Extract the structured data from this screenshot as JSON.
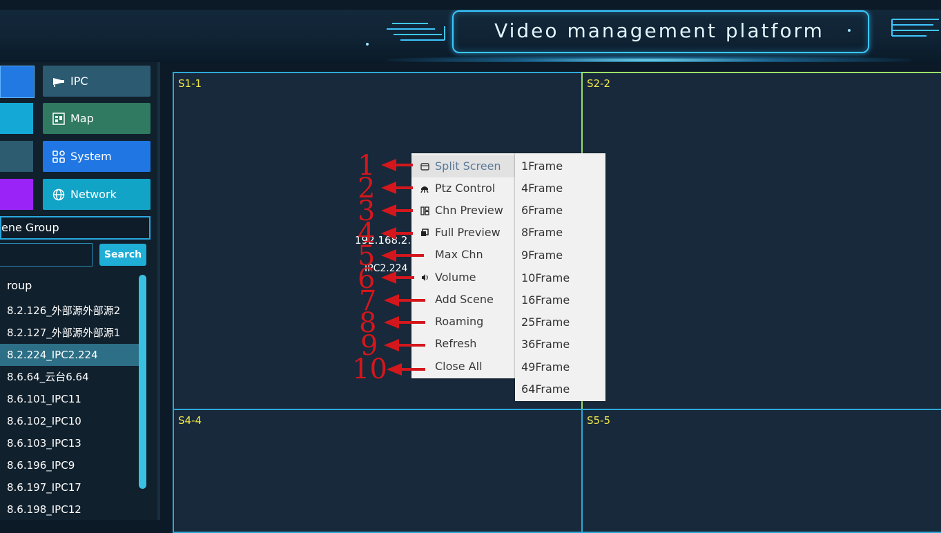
{
  "header": {
    "title": "Video management platform"
  },
  "nav": {
    "buttons": [
      {
        "label": "IPC",
        "icon": "camera-icon",
        "color": "#2c5a71",
        "left_color": "#2279e2"
      },
      {
        "label": "Map",
        "icon": "map-icon",
        "color": "#2f7a60",
        "left_color": "#13a8d6"
      },
      {
        "label": "System",
        "icon": "grid-icon",
        "color": "#2076e2",
        "left_color": "#2d5b70"
      },
      {
        "label": "Network",
        "icon": "globe-icon",
        "color": "#12a4c6",
        "left_color": "#9a23f7"
      }
    ]
  },
  "group_tab": {
    "label": "ene  Group"
  },
  "search": {
    "placeholder": "",
    "button_label": "Search"
  },
  "tree": {
    "root_label": "roup",
    "items": [
      {
        "label": "8.2.126_外部源外部源2",
        "selected": false
      },
      {
        "label": "8.2.127_外部源外部源1",
        "selected": false
      },
      {
        "label": "8.2.224_IPC2.224",
        "selected": true
      },
      {
        "label": "8.6.64_云台6.64",
        "selected": false
      },
      {
        "label": "8.6.101_IPC11",
        "selected": false
      },
      {
        "label": "8.6.102_IPC10",
        "selected": false
      },
      {
        "label": "8.6.103_IPC13",
        "selected": false
      },
      {
        "label": "8.6.196_IPC9",
        "selected": false
      },
      {
        "label": "8.6.197_IPC17",
        "selected": false
      },
      {
        "label": "8.6.198_IPC12",
        "selected": false
      }
    ]
  },
  "video_wall": {
    "cells": [
      {
        "label": "S1-1"
      },
      {
        "label": "S2-2"
      },
      {
        "label": "S4-4"
      },
      {
        "label": "S5-5"
      }
    ],
    "cell1_text_ip": "192.168.2.224",
    "cell1_text_name": "IPC2.224"
  },
  "context_menu": {
    "items": [
      {
        "label": "Split Screen",
        "icon": "window-icon"
      },
      {
        "label": "Ptz Control",
        "icon": "ptz-icon"
      },
      {
        "label": "Chn Preview",
        "icon": "channel-icon"
      },
      {
        "label": "Full Preview",
        "icon": "fullscreen-icon"
      },
      {
        "label": "Max Chn",
        "icon": ""
      },
      {
        "label": "Volume",
        "icon": "speaker-icon"
      },
      {
        "label": "Add Scene",
        "icon": ""
      },
      {
        "label": "Roaming",
        "icon": ""
      },
      {
        "label": "Refresh",
        "icon": ""
      },
      {
        "label": "Close All",
        "icon": ""
      }
    ]
  },
  "submenu": {
    "items": [
      "1Frame",
      "4Frame",
      "6Frame",
      "8Frame",
      "9Frame",
      "10Frame",
      "16Frame",
      "25Frame",
      "36Frame",
      "49Frame",
      "64Frame"
    ]
  },
  "annotations": {
    "numbers": [
      "1",
      "2",
      "3",
      "4",
      "5",
      "6",
      "7",
      "8",
      "9",
      "10"
    ],
    "color": "#d4171c"
  }
}
